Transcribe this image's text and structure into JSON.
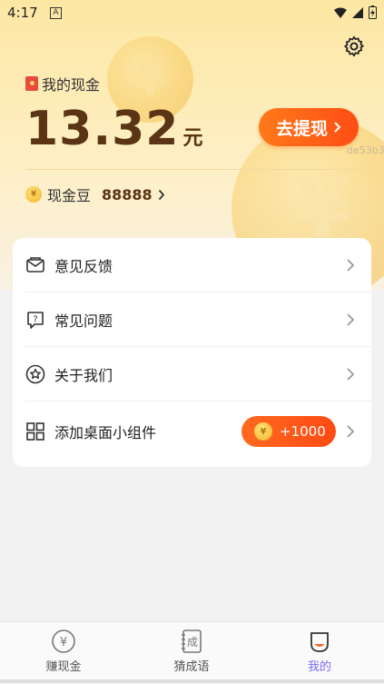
{
  "status": {
    "time": "4:17",
    "sim_label": "A"
  },
  "wallet": {
    "cash_label": "我的现金",
    "amount": "13.32",
    "unit": "元",
    "withdraw_label": "去提现",
    "watermark": "de53b3",
    "beans_label": "现金豆",
    "beans_value": "88888"
  },
  "menu": {
    "items": [
      {
        "label": "意见反馈",
        "icon": "mail-icon"
      },
      {
        "label": "常见问题",
        "icon": "question-bubble-icon"
      },
      {
        "label": "关于我们",
        "icon": "star-circle-icon"
      },
      {
        "label": "添加桌面小组件",
        "icon": "widget-grid-icon"
      }
    ],
    "widget_bonus": "+1000"
  },
  "tabs": [
    {
      "label": "赚现金",
      "icon": "yen-coin-icon",
      "active": false
    },
    {
      "label": "猜成语",
      "icon": "idiom-book-icon",
      "active": false
    },
    {
      "label": "我的",
      "icon": "profile-icon",
      "active": true
    }
  ],
  "colors": {
    "accent": "#ff5a14",
    "tab_active": "#7a6cf0",
    "amount": "#5a3414"
  }
}
